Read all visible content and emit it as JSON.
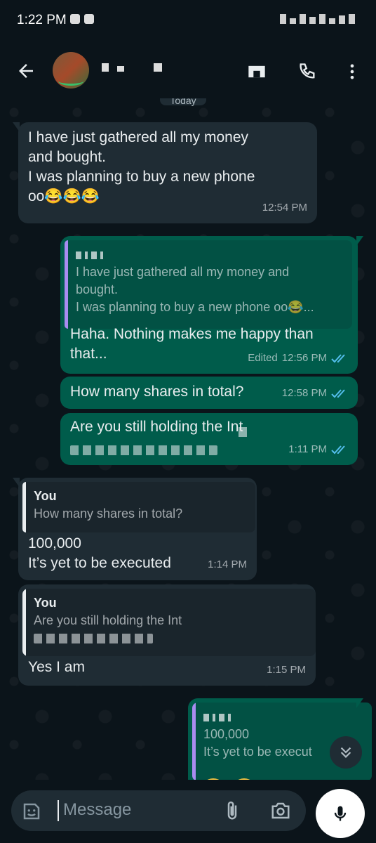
{
  "status_bar": {
    "time": "1:22 PM"
  },
  "header": {
    "date_chip": "Today"
  },
  "messages": [
    {
      "dir": "in",
      "text": "I have just gathered all my money\nand bought.\nI was planning to buy a new phone\noo😂😂😂",
      "time": "12:54 PM"
    },
    {
      "dir": "out",
      "quote": "I have just gathered all my money and\nbought.\nI was planning to buy a new phone oo😂...",
      "text": "Haha. Nothing makes me happy than\nthat...",
      "edited": "Edited",
      "time": "12:56 PM"
    },
    {
      "dir": "out",
      "text": "How many shares in total?",
      "time": "12:58 PM"
    },
    {
      "dir": "out",
      "text": "Are you still holding the Int",
      "time": "1:11 PM"
    },
    {
      "dir": "in",
      "quote_author": "You",
      "quote": "How many shares in total?",
      "text": "100,000\nIt’s yet to be executed",
      "time": "1:14 PM"
    },
    {
      "dir": "in",
      "quote_author": "You",
      "quote": "Are you still holding the Int",
      "text": "Yes I am",
      "time": "1:15 PM"
    },
    {
      "dir": "out",
      "quote": "100,000\nIt’s yet to be execut"
    }
  ],
  "input": {
    "placeholder": "Message"
  },
  "icons": {
    "back": "arrow-left-icon",
    "video": "video-call-icon",
    "call": "phone-icon",
    "menu": "more-vert-icon",
    "emoji": "sticker-icon",
    "attach": "paperclip-icon",
    "camera": "camera-icon",
    "mic": "microphone-icon",
    "scroll": "double-chevron-down-icon"
  },
  "colors": {
    "background": "#0b141a",
    "incoming": "#1f2c34",
    "outgoing": "#005c4b",
    "read_ticks": "#53bdeb"
  }
}
